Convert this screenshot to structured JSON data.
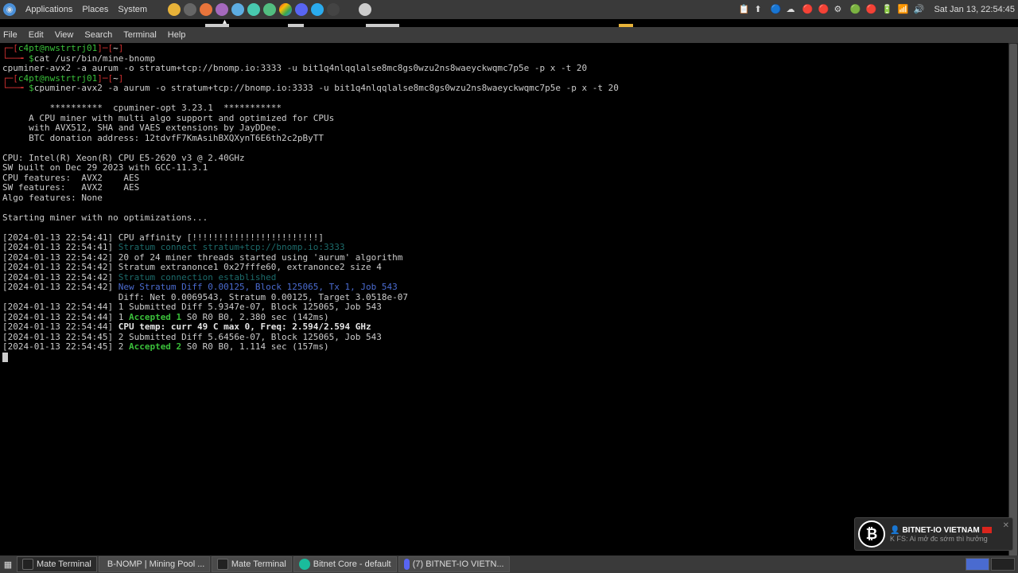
{
  "top": {
    "menus": [
      "Applications",
      "Places",
      "System"
    ],
    "clock": "Sat Jan 13, 22:54:45"
  },
  "menubar": [
    "File",
    "Edit",
    "View",
    "Search",
    "Terminal",
    "Help"
  ],
  "term": {
    "prompt_user": "c4pt@nwstrtrj01",
    "prompt_path": "~",
    "cmd1": "cat /usr/bin/mine-bnomp",
    "out1": "cpuminer-avx2 -a aurum -o stratum+tcp://bnomp.io:3333 -u bit1q4nlqqlalse8mc8gs0wzu2ns8waeyckwqmc7p5e -p x -t 20",
    "cmd2": "cpuminer-avx2 -a aurum -o stratum+tcp://bnomp.io:3333 -u bit1q4nlqqlalse8mc8gs0wzu2ns8waeyckwqmc7p5e -p x -t 20",
    "banner1": "         **********  cpuminer-opt 3.23.1  ***********",
    "banner2": "     A CPU miner with multi algo support and optimized for CPUs",
    "banner3": "     with AVX512, SHA and VAES extensions by JayDDee.",
    "banner4": "     BTC donation address: 12tdvfF7KmAsihBXQXynT6E6th2c2pByTT",
    "cpu": "CPU: Intel(R) Xeon(R) CPU E5-2620 v3 @ 2.40GHz",
    "sw": "SW built on Dec 29 2023 with GCC-11.3.1",
    "cpuf": "CPU features:  AVX2    AES",
    "swf": "SW features:   AVX2    AES",
    "algof": "Algo features: None",
    "start": "Starting miner with no optimizations...",
    "log": [
      {
        "ts": "[2024-01-13 22:54:41] ",
        "txt": "CPU affinity [!!!!!!!!!!!!!!!!!!!!!!!!]",
        "cls": ""
      },
      {
        "ts": "[2024-01-13 22:54:41] ",
        "txt": "Stratum connect stratum+tcp://bnomp.io:3333",
        "cls": "cyan"
      },
      {
        "ts": "[2024-01-13 22:54:42] ",
        "txt": "20 of 24 miner threads started using 'aurum' algorithm",
        "cls": ""
      },
      {
        "ts": "[2024-01-13 22:54:42] ",
        "txt": "Stratum extranonce1 0x27fffe60, extranonce2 size 4",
        "cls": ""
      },
      {
        "ts": "[2024-01-13 22:54:42] ",
        "txt": "Stratum connection established",
        "cls": "cyan"
      },
      {
        "ts": "[2024-01-13 22:54:42] ",
        "txt": "New Stratum Diff 0.00125, Block 125065, Tx 1, Job 543",
        "cls": "blue"
      },
      {
        "ts": "                      ",
        "txt": "Diff: Net 0.0069543, Stratum 0.00125, Target 3.0518e-07",
        "cls": ""
      },
      {
        "ts": "[2024-01-13 22:54:44] ",
        "txt": "1 Submitted Diff 5.9347e-07, Block 125065, Job 543",
        "cls": ""
      },
      {
        "ts": "[2024-01-13 22:54:44] ",
        "txt": "1 ",
        "cls": "",
        "accepted": "Accepted 1",
        "rest": " S0 R0 B0, 2.380 sec (142ms)"
      },
      {
        "ts": "[2024-01-13 22:54:44] ",
        "txt": "CPU temp: curr 49 C max 0, Freq: 2.594/2.594 GHz",
        "cls": "bold white"
      },
      {
        "ts": "[2024-01-13 22:54:45] ",
        "txt": "2 Submitted Diff 5.6456e-07, Block 125065, Job 543",
        "cls": ""
      },
      {
        "ts": "[2024-01-13 22:54:45] ",
        "txt": "2 ",
        "cls": "",
        "accepted": "Accepted 2",
        "rest": " S0 R0 B0, 1.114 sec (157ms)"
      }
    ]
  },
  "notification": {
    "title": "BITNET-IO VIETNAM",
    "sub": "K FS: Ai mở đc sớm thì hưởng"
  },
  "taskbar": [
    {
      "label": "Mate Terminal",
      "icon": "terminal",
      "active": true
    },
    {
      "label": "B-NOMP | Mining Pool ...",
      "icon": "firefox"
    },
    {
      "label": "Mate Terminal",
      "icon": "terminal"
    },
    {
      "label": "Bitnet Core - default",
      "icon": "bitnet"
    },
    {
      "label": "(7) BITNET-IO VIETN...",
      "icon": "discord"
    }
  ]
}
